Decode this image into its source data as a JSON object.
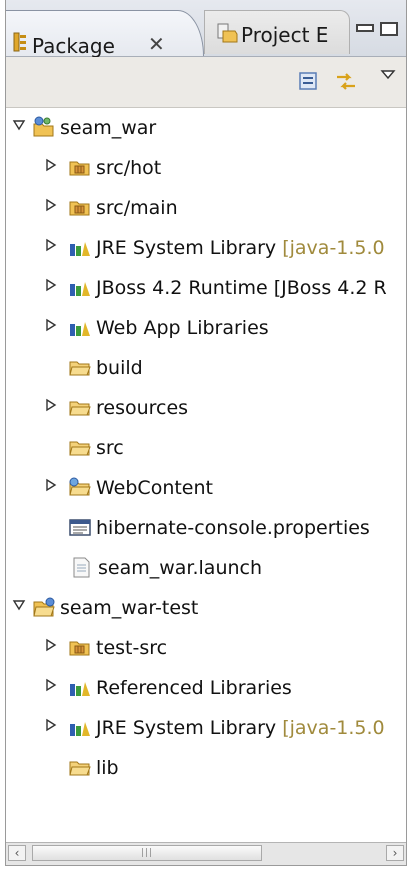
{
  "tabs": {
    "active_label": "Package",
    "inactive_label": "Project E"
  },
  "tree": {
    "rows": [
      {
        "label": "seam_war",
        "decoration": ""
      },
      {
        "label": "src/hot",
        "decoration": ""
      },
      {
        "label": "src/main",
        "decoration": ""
      },
      {
        "label": "JRE System Library ",
        "decoration": "[java-1.5.0"
      },
      {
        "label": "JBoss 4.2 Runtime [JBoss 4.2 R",
        "decoration": ""
      },
      {
        "label": "Web App Libraries",
        "decoration": ""
      },
      {
        "label": "build",
        "decoration": ""
      },
      {
        "label": "resources",
        "decoration": ""
      },
      {
        "label": "src",
        "decoration": ""
      },
      {
        "label": "WebContent",
        "decoration": ""
      },
      {
        "label": "hibernate-console.properties",
        "decoration": ""
      },
      {
        "label": "seam_war.launch",
        "decoration": ""
      },
      {
        "label": "seam_war-test",
        "decoration": ""
      },
      {
        "label": "test-src",
        "decoration": ""
      },
      {
        "label": "Referenced Libraries",
        "decoration": ""
      },
      {
        "label": "JRE System Library ",
        "decoration": "[java-1.5.0"
      },
      {
        "label": "lib",
        "decoration": ""
      }
    ]
  },
  "icons": {
    "project": "java-project-icon",
    "source_folder": "package-folder-icon",
    "library": "library-icon",
    "folder": "folder-icon",
    "properties_file": "properties-file-icon",
    "file": "file-icon"
  },
  "colors": {
    "decoration": "#a08a3c",
    "folder": "#e8b84a",
    "library_green": "#3b9c3b"
  }
}
